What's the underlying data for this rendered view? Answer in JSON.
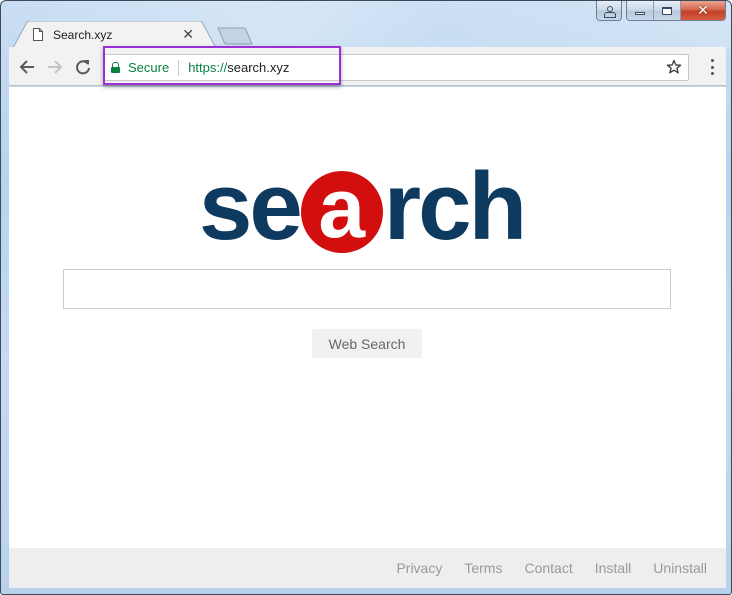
{
  "window": {
    "caption_buttons": [
      "user-profile",
      "minimize",
      "maximize",
      "close"
    ]
  },
  "tabs": [
    {
      "title": "Search.xyz",
      "icon": "file-icon",
      "active": true
    }
  ],
  "toolbar": {
    "back_icon": "arrow-left-icon",
    "forward_icon": "arrow-right-icon",
    "reload_icon": "reload-icon",
    "security_label": "Secure",
    "url_scheme": "https://",
    "url_host": "search.xyz",
    "bookmark_icon": "star-icon",
    "menu_icon": "vertical-dots-icon"
  },
  "annotation": {
    "highlight_color": "#9b30d9"
  },
  "page": {
    "logo": {
      "text_before": "se",
      "highlight_letter": "a",
      "text_after": "rch",
      "primary_color": "#0e3a5f",
      "accent_color": "#d20e0e"
    },
    "search_input": {
      "value": "",
      "placeholder": ""
    },
    "search_button_label": "Web Search",
    "footer_links": [
      "Privacy",
      "Terms",
      "Contact",
      "Install",
      "Uninstall"
    ]
  }
}
